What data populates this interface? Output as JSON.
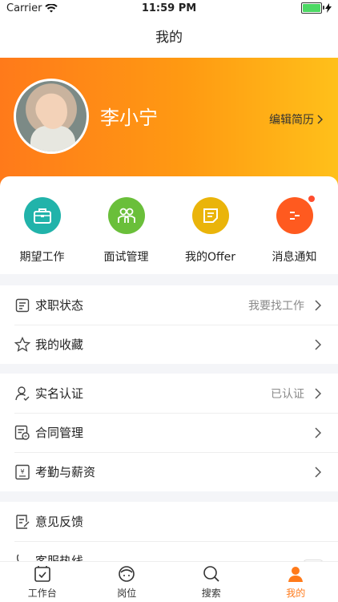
{
  "status": {
    "carrier": "Carrier",
    "time": "11:59 PM"
  },
  "nav": {
    "title": "我的"
  },
  "profile": {
    "name": "李小宁",
    "edit_label": "编辑简历"
  },
  "quick": [
    {
      "label": "期望工作",
      "icon": "briefcase-icon",
      "color": "#21b3aa"
    },
    {
      "label": "面试管理",
      "icon": "people-icon",
      "color": "#6abf3a"
    },
    {
      "label": "我的Offer",
      "icon": "document-icon",
      "color": "#eab40a"
    },
    {
      "label": "消息通知",
      "icon": "chat-icon",
      "color": "#ff5a1f"
    }
  ],
  "section1": [
    {
      "label": "求职状态",
      "value": "我要找工作"
    },
    {
      "label": "我的收藏",
      "value": ""
    }
  ],
  "section2": [
    {
      "label": "实名认证",
      "value": "已认证"
    },
    {
      "label": "合同管理",
      "value": ""
    },
    {
      "label": "考勤与薪资",
      "value": ""
    }
  ],
  "section3": [
    {
      "label": "意见反馈",
      "value": ""
    },
    {
      "label": "客服热线",
      "value": ""
    }
  ],
  "tabs": [
    {
      "label": "工作台",
      "icon": "workbench-icon"
    },
    {
      "label": "岗位",
      "icon": "job-icon"
    },
    {
      "label": "搜索",
      "icon": "search-icon"
    },
    {
      "label": "我的",
      "icon": "profile-icon"
    }
  ],
  "colors": {
    "accent": "#ff7a1a",
    "gradient_end": "#ffc01a"
  }
}
